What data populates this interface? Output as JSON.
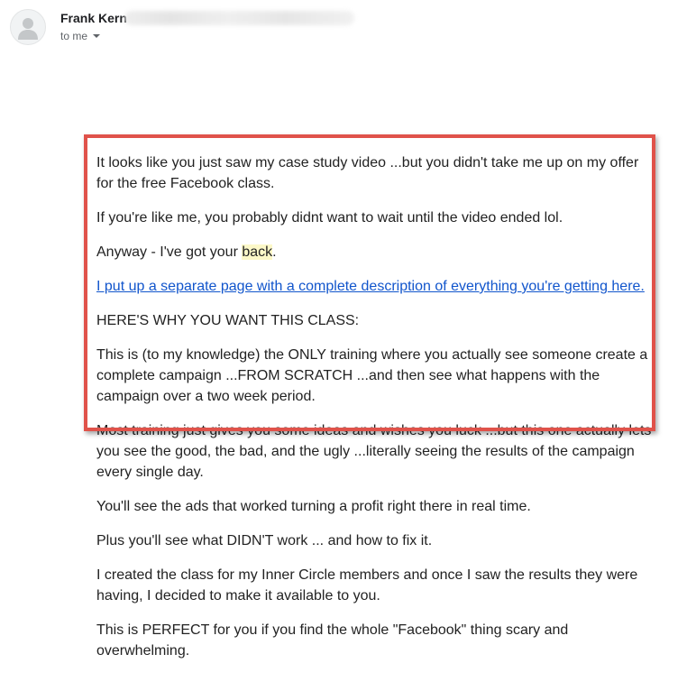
{
  "header": {
    "sender_name": "Frank Kern",
    "recipient_label": "to me"
  },
  "message": {
    "paragraphs": {
      "p1": "It looks like you just saw my case study video ...but you didn't take me up on my offer for the free Facebook class.",
      "p2": "If you're like me, you probably didnt want to wait until the video ended lol.",
      "p3_prefix": "Anyway - I've got your ",
      "p3_highlight": "back",
      "p3_suffix": ".",
      "p4_link": "I put up a separate page with a complete description of everything you're getting here.",
      "p5": "HERE'S WHY YOU WANT THIS CLASS:",
      "p6": "This is (to my knowledge) the ONLY training where you actually see someone create a complete campaign ...FROM SCRATCH ...and then see what happens with the campaign over a two week period.",
      "p7": "Most training just gives you some ideas and wishes you luck ...but this one actually lets you see the good, the bad, and the ugly ...literally seeing the results of the campaign every single day.",
      "p8": "You'll see the ads that worked turning a profit right there in real time.",
      "p9": "Plus you'll see what DIDN'T work ... and how to fix it.",
      "p10": "I created the class for my Inner Circle members and once I saw the results they were having, I decided to make it available to you.",
      "p11": "This is PERFECT for you if you find the whole \"Facebook\" thing scary and overwhelming."
    }
  },
  "icons": {
    "avatar": "default-person-icon",
    "recipient_toggle": "caret-down-icon"
  },
  "colors": {
    "annotation_box": "#e0524a",
    "link": "#1155cc",
    "highlight": "#fcf8c8"
  }
}
